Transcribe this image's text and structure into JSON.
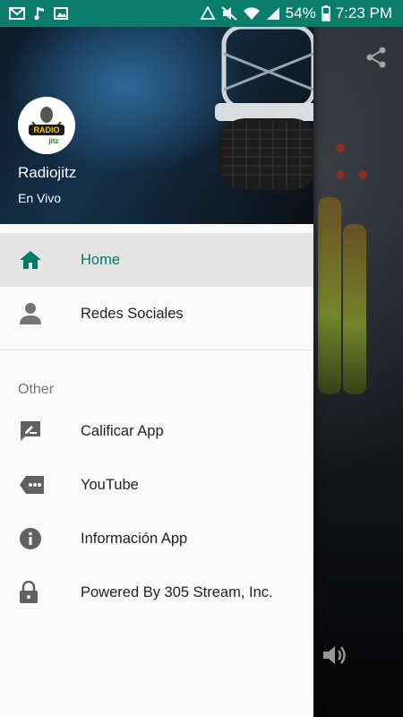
{
  "status_bar": {
    "battery": "54%",
    "time": "7:23 PM",
    "left_icons": [
      "mail-icon",
      "music-note-icon",
      "image-icon"
    ],
    "right_icons": [
      "recycle-icon",
      "mute-icon",
      "wifi-icon",
      "signal-icon",
      "battery-icon"
    ]
  },
  "header": {
    "logo_text": "RADIO jitz",
    "title": "Radiojitz",
    "subtitle": "En Vivo"
  },
  "menu": {
    "items": [
      {
        "label": "Home",
        "icon": "home-icon",
        "active": true
      },
      {
        "label": "Redes Sociales",
        "icon": "person-icon",
        "active": false
      }
    ],
    "section_label": "Other",
    "other_items": [
      {
        "label": "Calificar App",
        "icon": "rate-review-icon"
      },
      {
        "label": "YouTube",
        "icon": "label-more-icon"
      },
      {
        "label": "Información App",
        "icon": "info-icon"
      },
      {
        "label": "Powered By 305 Stream, Inc.",
        "icon": "lock-icon"
      }
    ]
  },
  "background_app": {
    "icons": [
      "share-icon",
      "volume-icon"
    ]
  },
  "colors": {
    "status_bar": "#0a7d6c",
    "accent": "#00796b",
    "active_item_bg": "#e4e4e4"
  }
}
